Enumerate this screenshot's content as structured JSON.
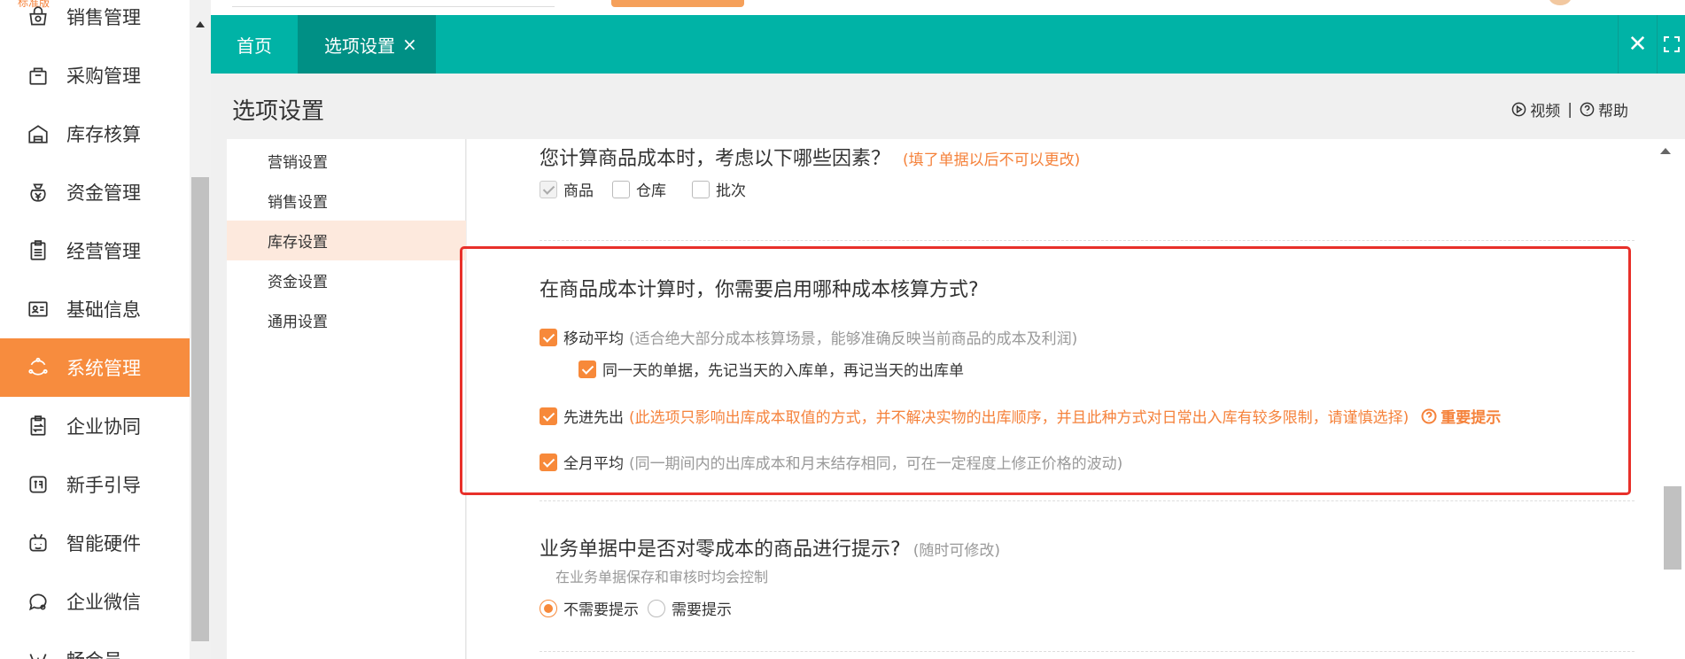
{
  "app": {
    "version_badge": "标准版"
  },
  "sidebar": {
    "items": [
      {
        "label": "销售管理",
        "icon": "sales-icon"
      },
      {
        "label": "采购管理",
        "icon": "bag-icon"
      },
      {
        "label": "库存核算",
        "icon": "warehouse-icon"
      },
      {
        "label": "资金管理",
        "icon": "money-icon"
      },
      {
        "label": "经营管理",
        "icon": "clipboard-icon"
      },
      {
        "label": "基础信息",
        "icon": "id-card-icon"
      },
      {
        "label": "系统管理",
        "icon": "system-icon",
        "active": true
      },
      {
        "label": "企业协同",
        "icon": "sync-icon"
      },
      {
        "label": "新手引导",
        "icon": "new-icon"
      },
      {
        "label": "智能硬件",
        "icon": "robot-icon"
      },
      {
        "label": "企业微信",
        "icon": "chat-icon"
      },
      {
        "label": "畅会员",
        "icon": "vip-icon"
      }
    ]
  },
  "tabs": {
    "home": "首页",
    "options": "选项设置",
    "close_glyph": "×",
    "close_all_glyph": "✕"
  },
  "header": {
    "title": "选项设置",
    "video": "视频",
    "separator": "|",
    "help": "帮助"
  },
  "settings_menu": {
    "items": [
      {
        "label": "营销设置"
      },
      {
        "label": "销售设置"
      },
      {
        "label": "库存设置",
        "active": true
      },
      {
        "label": "资金设置"
      },
      {
        "label": "通用设置"
      }
    ]
  },
  "panel": {
    "q1": {
      "title": "您计算商品成本时，考虑以下哪些因素？",
      "note": "(填了单据以后不可以更改)",
      "options": [
        {
          "label": "商品",
          "checked": true,
          "disabled": true
        },
        {
          "label": "仓库",
          "checked": false
        },
        {
          "label": "批次",
          "checked": false
        }
      ]
    },
    "q2": {
      "title": "在商品成本计算时，你需要启用哪种成本核算方式?",
      "moving_avg": {
        "label": "移动平均",
        "desc": "(适合绝大部分成本核算场景，能够准确反映当前商品的成本及利润)",
        "checked": true
      },
      "same_day": {
        "label": "同一天的单据，先记当天的入库单，再记当天的出库单",
        "checked": true
      },
      "fifo": {
        "label": "先进先出",
        "desc": "(此选项只影响出库成本取值的方式，并不解决实物的出库顺序，并且此种方式对日常出入库有较多限制，请谨慎选择)",
        "tip": "重要提示",
        "checked": true
      },
      "monthly_avg": {
        "label": "全月平均",
        "desc": "(同一期间内的出库成本和月末结存相同，可在一定程度上修正价格的波动)",
        "checked": true
      }
    },
    "q3": {
      "title": "业务单据中是否对零成本的商品进行提示?",
      "note": "(随时可修改)",
      "sub": "在业务单据保存和审核时均会控制",
      "options": [
        {
          "label": "不需要提示",
          "checked": true
        },
        {
          "label": "需要提示",
          "checked": false
        }
      ]
    }
  },
  "colors": {
    "accent": "#00b3a6",
    "accent_dark": "#009085",
    "orange": "#f7893a",
    "highlight": "#e8302a"
  }
}
